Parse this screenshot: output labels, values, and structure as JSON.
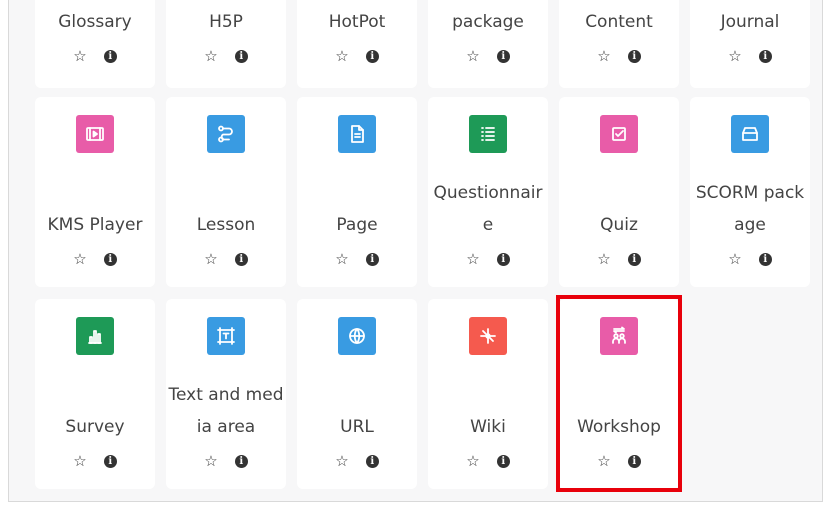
{
  "colors": {
    "purple": "#e85ca8",
    "blue": "#399be2",
    "green": "#1e9a57",
    "red": "#f55a4e",
    "highlight": "#e8000b"
  },
  "activities": [
    {
      "label": "Glossary",
      "icon": "none"
    },
    {
      "label": "H5P",
      "icon": "none"
    },
    {
      "label": "HotPot",
      "icon": "none"
    },
    {
      "label": "package",
      "icon": "none"
    },
    {
      "label": "Content",
      "icon": "none"
    },
    {
      "label": "Journal",
      "icon": "none"
    },
    {
      "label": "KMS Player",
      "icon": "video-icon"
    },
    {
      "label": "Lesson",
      "icon": "path-icon"
    },
    {
      "label": "Page",
      "icon": "document-icon"
    },
    {
      "label": "Questionnaire",
      "icon": "list-icon"
    },
    {
      "label": "Quiz",
      "icon": "checkbox-icon"
    },
    {
      "label": "SCORM package",
      "icon": "box-icon"
    },
    {
      "label": "Survey",
      "icon": "bar-chart-icon"
    },
    {
      "label": "Text and media area",
      "icon": "text-frame-icon"
    },
    {
      "label": "URL",
      "icon": "globe-icon"
    },
    {
      "label": "Wiki",
      "icon": "network-icon"
    },
    {
      "label": "Workshop",
      "icon": "people-exchange-icon"
    }
  ],
  "actions": {
    "star_glyph": "☆",
    "info_glyph": "i"
  },
  "selected": "Workshop"
}
